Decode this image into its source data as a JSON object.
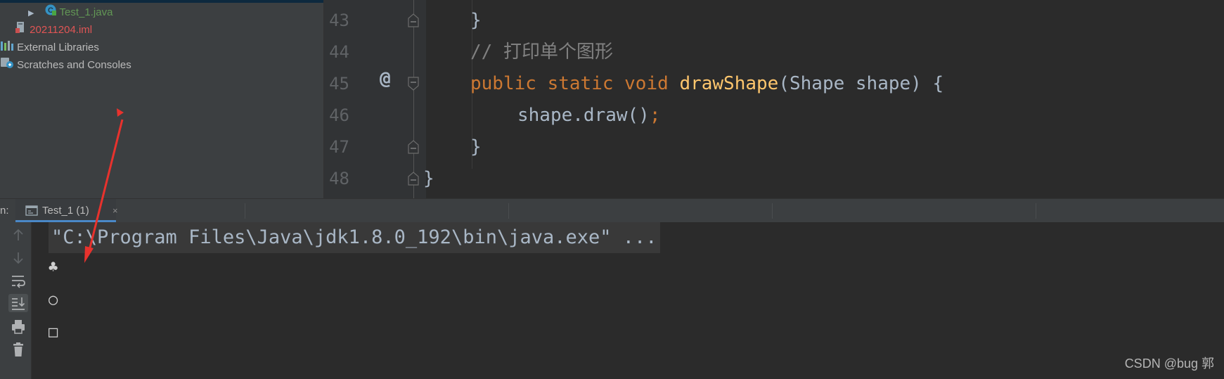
{
  "project_tree": {
    "items": [
      {
        "label": "Test_1.java",
        "type": "java-class",
        "color": "green"
      },
      {
        "label": "20211204.iml",
        "type": "module-file",
        "color": "red"
      },
      {
        "label": "External Libraries",
        "type": "libraries"
      },
      {
        "label": "Scratches and Consoles",
        "type": "scratches"
      }
    ]
  },
  "editor": {
    "line_numbers": [
      "43",
      "44",
      "45",
      "46",
      "47",
      "48"
    ],
    "gutter_marker": "@",
    "lines": {
      "l43": {
        "brace": "}"
      },
      "l44": {
        "comment": "// 打印单个图形"
      },
      "l45": {
        "kw_public": "public",
        "kw_static": "static",
        "kw_void": "void",
        "method": "drawShape",
        "params": "(Shape shape) {"
      },
      "l46": {
        "call": "shape.draw()",
        "semicolon": ";"
      },
      "l47": {
        "brace": "}"
      },
      "l48": {
        "brace": "}"
      }
    }
  },
  "run_window": {
    "label": "n:",
    "tab_label": "Test_1 (1)",
    "tab_close": "×",
    "command": "\"C:\\Program Files\\Java\\jdk1.8.0_192\\bin\\java.exe\" ...",
    "output": [
      "♣",
      "○",
      "□"
    ],
    "toolbar_icons": [
      "up-arrow-icon",
      "down-arrow-icon",
      "soft-wrap-icon",
      "scroll-to-end-icon",
      "print-icon",
      "trash-icon"
    ]
  },
  "watermark": "CSDN @bug 郭",
  "colors": {
    "keyword": "#cc7832",
    "method": "#ffc66d",
    "comment": "#808080",
    "text": "#a9b7c6",
    "annotation_arrow": "#e8322d"
  }
}
